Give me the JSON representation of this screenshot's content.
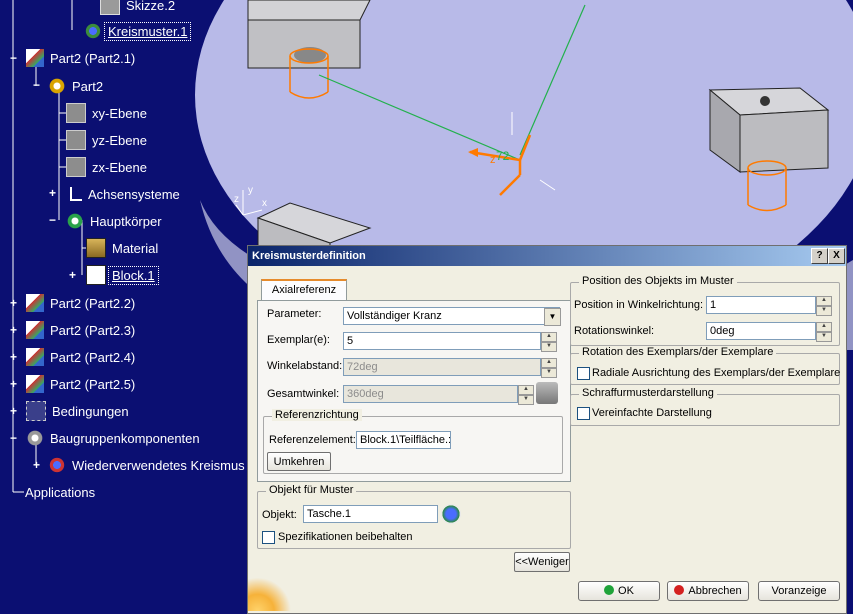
{
  "tree": {
    "items": [
      {
        "label": "Skizze.2",
        "level": 5
      },
      {
        "label": "Kreismuster.1",
        "level": 5,
        "selected": true
      },
      {
        "label": "Part2 (Part2.1)",
        "level": 1
      },
      {
        "label": "Part2",
        "level": 2
      },
      {
        "label": "xy-Ebene",
        "level": 3
      },
      {
        "label": "yz-Ebene",
        "level": 3
      },
      {
        "label": "zx-Ebene",
        "level": 3
      },
      {
        "label": "Achsensysteme",
        "level": 3
      },
      {
        "label": "Hauptkörper",
        "level": 3
      },
      {
        "label": "Material",
        "level": 4
      },
      {
        "label": "Block.1",
        "level": 4,
        "selected": true
      },
      {
        "label": "Part2 (Part2.2)",
        "level": 1
      },
      {
        "label": "Part2 (Part2.3)",
        "level": 1
      },
      {
        "label": "Part2 (Part2.4)",
        "level": 1
      },
      {
        "label": "Part2 (Part2.5)",
        "level": 1
      },
      {
        "label": "Bedingungen",
        "level": 1
      },
      {
        "label": "Baugruppenkomponenten",
        "level": 1
      },
      {
        "label": "Wiederverwendetes Kreismus",
        "level": 2
      },
      {
        "label": "Applications",
        "level": 0
      }
    ]
  },
  "viewport": {
    "label_z": "z",
    "angle_label": "72",
    "axis_y": "y",
    "axis_x": "x",
    "axis_z": "z"
  },
  "dialog": {
    "title": "Kreismusterdefinition",
    "help_btn": "?",
    "close_btn": "X",
    "tab_label": "Axialreferenz",
    "parameter_label": "Parameter:",
    "parameter_value": "Vollständiger Kranz",
    "exemplare_label": "Exemplar(e):",
    "exemplare_value": "5",
    "winkelabstand_label": "Winkelabstand:",
    "winkelabstand_value": "72deg",
    "gesamtwinkel_label": "Gesamtwinkel:",
    "gesamtwinkel_value": "360deg",
    "referenzrichtung_title": "Referenzrichtung",
    "referenzelement_label": "Referenzelement:",
    "referenzelement_value": "Block.1\\Teilfläche.:",
    "umkehren_btn": "Umkehren",
    "objekt_group": "Objekt für Muster",
    "objekt_label": "Objekt:",
    "objekt_value": "Tasche.1",
    "spezifikationen_label": "Spezifikationen beibehalten",
    "weniger_btn": "<<Weniger",
    "position_group": "Position des Objekts im Muster",
    "position_winkel_label": "Position in Winkelrichtung:",
    "position_winkel_value": "1",
    "rotationswinkel_label": "Rotationswinkel:",
    "rotationswinkel_value": "0deg",
    "rotation_group": "Rotation des Exemplars/der Exemplare",
    "radiale_label": "Radiale Ausrichtung des Exemplars/der Exemplare",
    "schraffur_group": "Schraffurmusterdarstellung",
    "vereinfachte_label": "Vereinfachte Darstellung",
    "ok_btn": "OK",
    "abbrechen_btn": "Abbrechen",
    "voranzeige_btn": "Voranzeige"
  },
  "colors": {
    "background": "#0b0f72",
    "part_face": "#b8bae8",
    "block": "#c8c8cc",
    "highlight": "#ff7a00",
    "axis_line": "#22b14c"
  }
}
